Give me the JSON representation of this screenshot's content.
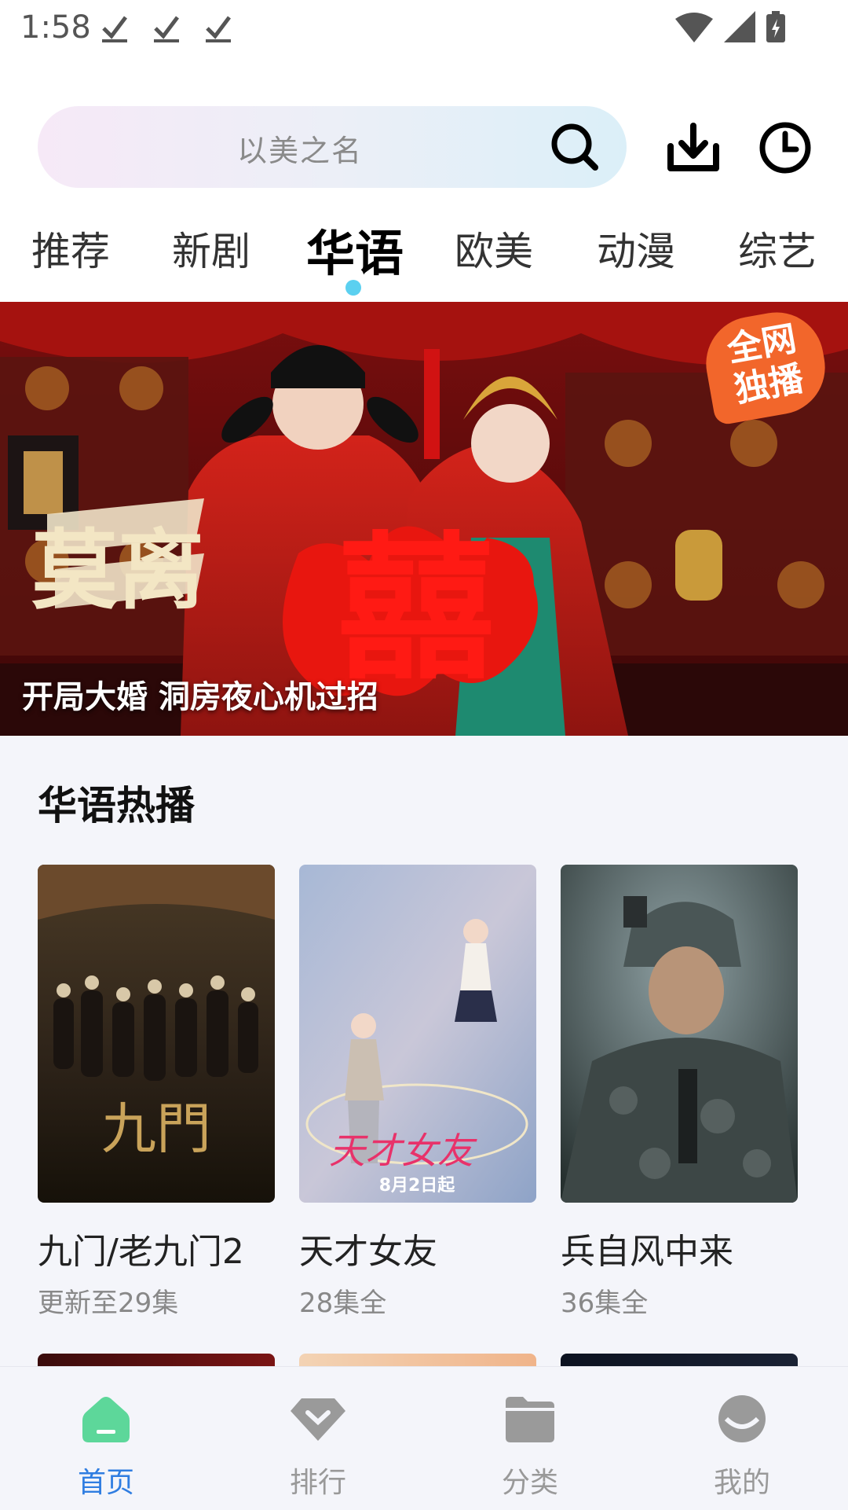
{
  "status_bar": {
    "time": "1:58"
  },
  "search": {
    "placeholder": "以美之名"
  },
  "tabs": [
    {
      "label": "推荐"
    },
    {
      "label": "新剧"
    },
    {
      "label": "华语",
      "active": true
    },
    {
      "label": "欧美"
    },
    {
      "label": "动漫"
    },
    {
      "label": "综艺"
    }
  ],
  "banner": {
    "caption": "开局大婚 洞房夜心机过招",
    "badge_line1": "全网",
    "badge_line2": "独播",
    "show_title": "莫离",
    "big_char": "囍"
  },
  "section": {
    "title": "华语热播",
    "cards": [
      {
        "title": "九门/老九门2",
        "subtitle": "更新至29集",
        "poster_text": "九門"
      },
      {
        "title": "天才女友",
        "subtitle": "28集全",
        "poster_text": "天才女友",
        "poster_date": "8月2日起"
      },
      {
        "title": "兵自风中来",
        "subtitle": "36集全"
      }
    ]
  },
  "bottom_nav": [
    {
      "label": "首页",
      "icon": "home-icon",
      "active": true
    },
    {
      "label": "排行",
      "icon": "ranking-icon"
    },
    {
      "label": "分类",
      "icon": "category-folder-icon"
    },
    {
      "label": "我的",
      "icon": "profile-icon"
    }
  ],
  "colors": {
    "accent": "#2f7de1",
    "home_icon": "#5dd79a",
    "tab_indicator": "#5bd0f0",
    "badge": "#f2662b"
  }
}
